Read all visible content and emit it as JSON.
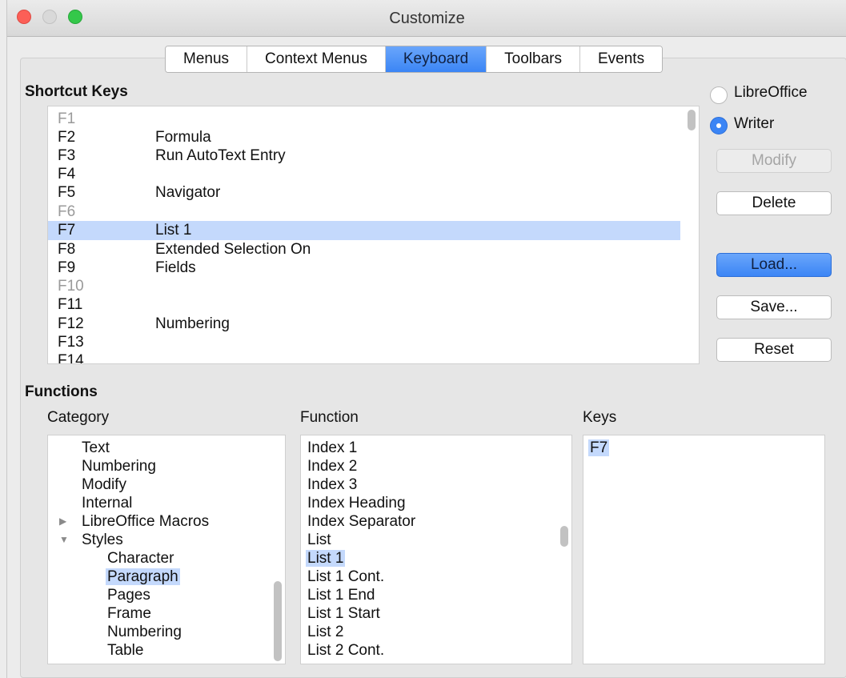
{
  "window": {
    "title": "Customize"
  },
  "tabs": [
    {
      "label": "Menus",
      "active": false
    },
    {
      "label": "Context Menus",
      "active": false
    },
    {
      "label": "Keyboard",
      "active": true
    },
    {
      "label": "Toolbars",
      "active": false
    },
    {
      "label": "Events",
      "active": false
    }
  ],
  "shortcut_keys": {
    "heading": "Shortcut Keys",
    "rows": [
      {
        "key": "F1",
        "function": "",
        "dim": true
      },
      {
        "key": "F2",
        "function": "Formula",
        "dim": false
      },
      {
        "key": "F3",
        "function": "Run AutoText Entry",
        "dim": false
      },
      {
        "key": "F4",
        "function": "",
        "dim": false
      },
      {
        "key": "F5",
        "function": "Navigator",
        "dim": false
      },
      {
        "key": "F6",
        "function": "",
        "dim": true
      },
      {
        "key": "F7",
        "function": "List 1",
        "dim": false,
        "selected": true
      },
      {
        "key": "F8",
        "function": "Extended Selection On",
        "dim": false
      },
      {
        "key": "F9",
        "function": "Fields",
        "dim": false
      },
      {
        "key": "F10",
        "function": "",
        "dim": true
      },
      {
        "key": "F11",
        "function": "",
        "dim": false
      },
      {
        "key": "F12",
        "function": "Numbering",
        "dim": false
      },
      {
        "key": "F13",
        "function": "",
        "dim": false
      },
      {
        "key": "F14",
        "function": "",
        "dim": false
      }
    ]
  },
  "scope": {
    "options": [
      {
        "label": "LibreOffice",
        "selected": false
      },
      {
        "label": "Writer",
        "selected": true
      }
    ]
  },
  "buttons": {
    "modify": "Modify",
    "delete": "Delete",
    "load": "Load...",
    "save": "Save...",
    "reset": "Reset"
  },
  "functions": {
    "heading": "Functions",
    "category_label": "Category",
    "function_label": "Function",
    "keys_label": "Keys",
    "categories": [
      {
        "label": "Text",
        "indent": 0,
        "arrow": ""
      },
      {
        "label": "Numbering",
        "indent": 0,
        "arrow": ""
      },
      {
        "label": "Modify",
        "indent": 0,
        "arrow": ""
      },
      {
        "label": "Internal",
        "indent": 0,
        "arrow": ""
      },
      {
        "label": "LibreOffice Macros",
        "indent": 0,
        "arrow": "collapsed"
      },
      {
        "label": "Styles",
        "indent": 0,
        "arrow": "expanded"
      },
      {
        "label": "Character",
        "indent": 1,
        "arrow": ""
      },
      {
        "label": "Paragraph",
        "indent": 1,
        "arrow": "",
        "selected": true
      },
      {
        "label": "Pages",
        "indent": 1,
        "arrow": ""
      },
      {
        "label": "Frame",
        "indent": 1,
        "arrow": ""
      },
      {
        "label": "Numbering",
        "indent": 1,
        "arrow": ""
      },
      {
        "label": "Table",
        "indent": 1,
        "arrow": ""
      }
    ],
    "functions_list": [
      {
        "label": "Index 1"
      },
      {
        "label": "Index 2"
      },
      {
        "label": "Index 3"
      },
      {
        "label": "Index Heading"
      },
      {
        "label": "Index Separator"
      },
      {
        "label": "List"
      },
      {
        "label": "List 1",
        "selected": true
      },
      {
        "label": "List 1 Cont."
      },
      {
        "label": "List 1 End"
      },
      {
        "label": "List 1 Start"
      },
      {
        "label": "List 2"
      },
      {
        "label": "List 2 Cont."
      }
    ],
    "keys": [
      {
        "label": "F7",
        "selected": true
      }
    ]
  }
}
